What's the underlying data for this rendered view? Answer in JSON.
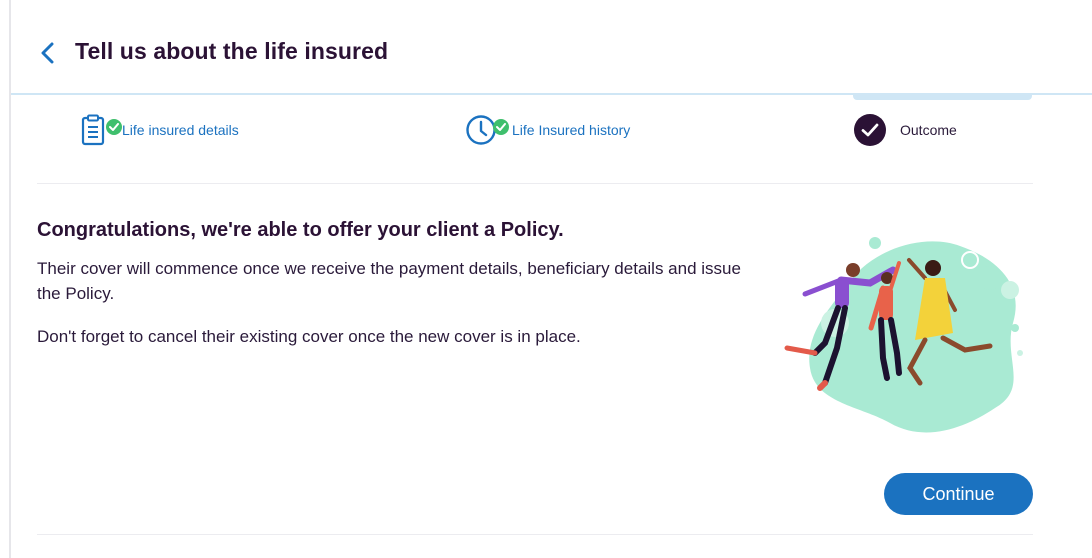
{
  "header": {
    "title": "Tell us about the life insured"
  },
  "steps": [
    {
      "label": "Life insured details",
      "icon": "clipboard-icon",
      "status": "complete"
    },
    {
      "label": "Life Insured history",
      "icon": "clock-icon",
      "status": "complete"
    },
    {
      "label": "Outcome",
      "icon": "check-circle-icon",
      "status": "current"
    }
  ],
  "content": {
    "title": "Congratulations, we're able to offer your client a Policy.",
    "paragraph1": "Their cover will commence once we receive the payment details, beneficiary details and issue the Policy.",
    "paragraph2": "Don't forget to cancel their existing cover once the new cover is in place."
  },
  "actions": {
    "continue_label": "Continue"
  },
  "colors": {
    "primary": "#1b72c0",
    "heading": "#2b1235",
    "success": "#3fbf6d",
    "illustration_blob": "#a9ead3"
  }
}
